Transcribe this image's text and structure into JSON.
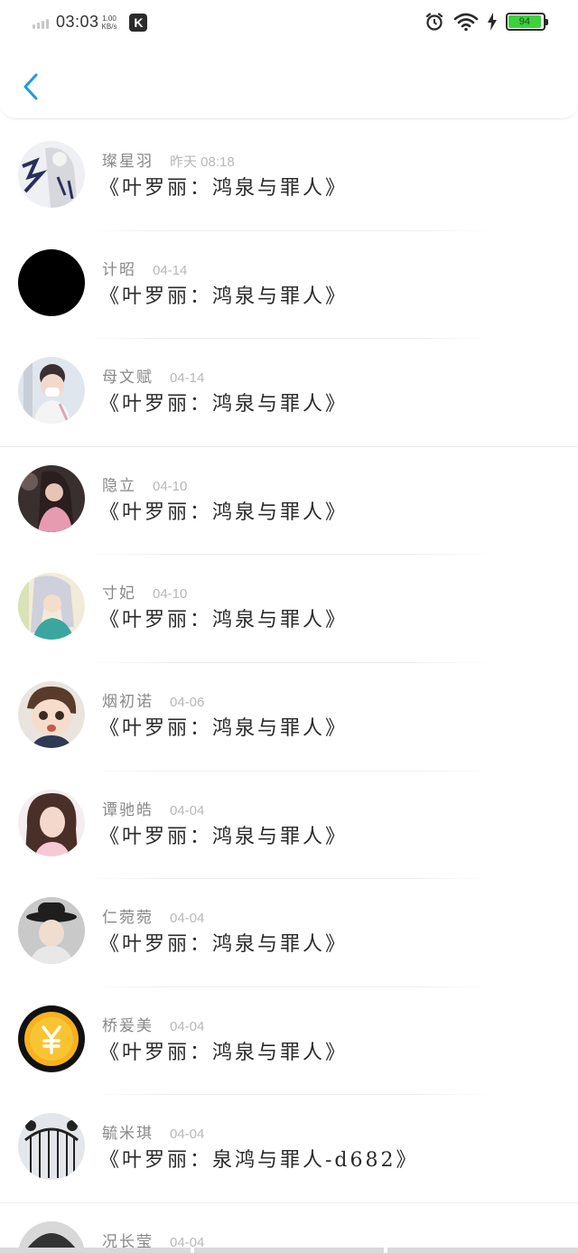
{
  "status_bar": {
    "time": "03:03",
    "net_speed_value": "1.00",
    "net_speed_unit": "KB/s",
    "app_badge": "K",
    "battery_level": "94",
    "battery_fraction": 0.94,
    "battery_color": "#3dd13d",
    "icons": [
      "signal-icon",
      "alarm-icon",
      "wifi-icon",
      "charging-icon",
      "battery-icon"
    ]
  },
  "nav": {
    "back_icon": "chevron-left-icon",
    "accent": "#1a9be6"
  },
  "comments": [
    {
      "name": "璨星羽",
      "date": "昨天 08:18",
      "title": "《叶罗丽：鸿泉与罪人》",
      "avatar": "avatar-ink-drawing"
    },
    {
      "name": "计昭",
      "date": "04-14",
      "title": "《叶罗丽：鸿泉与罪人》",
      "avatar": "avatar-black-circle"
    },
    {
      "name": "母文赋",
      "date": "04-14",
      "title": "《叶罗丽：鸿泉与罪人》",
      "avatar": "avatar-child-mask"
    },
    {
      "name": "隐立",
      "date": "04-10",
      "title": "《叶罗丽：鸿泉与罪人》",
      "avatar": "avatar-girl-pink"
    },
    {
      "name": "寸妃",
      "date": "04-10",
      "title": "《叶罗丽：鸿泉与罪人》",
      "avatar": "avatar-anime-silver-hair"
    },
    {
      "name": "烟初诺",
      "date": "04-06",
      "title": "《叶罗丽：鸿泉与罪人》",
      "avatar": "avatar-anime-boy"
    },
    {
      "name": "谭驰皓",
      "date": "04-04",
      "title": "《叶罗丽：鸿泉与罪人》",
      "avatar": "avatar-woman-portrait"
    },
    {
      "name": "仁菀菀",
      "date": "04-04",
      "title": "《叶罗丽：鸿泉与罪人》",
      "avatar": "avatar-girl-hat"
    },
    {
      "name": "桥爰美",
      "date": "04-04",
      "title": "《叶罗丽：鸿泉与罪人》",
      "avatar": "avatar-yen-coin"
    },
    {
      "name": "毓米琪",
      "date": "04-04",
      "title": "《叶罗丽：泉鸿与罪人-d682》",
      "avatar": "avatar-gate"
    },
    {
      "name": "况长莹",
      "date": "04-04",
      "title": "",
      "avatar": "avatar-partial"
    }
  ]
}
